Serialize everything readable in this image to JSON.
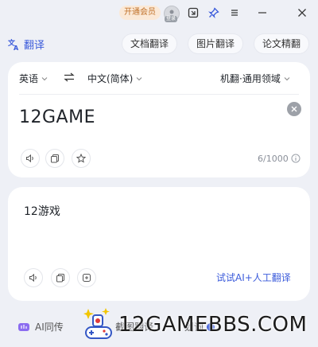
{
  "titlebar": {
    "vip_label": "开通会员",
    "avatar_label": "登录"
  },
  "toolbar": {
    "brand": "翻译",
    "doc_translate": "文档翻译",
    "image_translate": "图片翻译",
    "paper_polish": "论文精翻"
  },
  "source": {
    "lang": "英语",
    "target_lang": "中文(简体)",
    "engine": "机翻·通用领域",
    "text": "12GAME",
    "counter": "6/1000"
  },
  "result": {
    "text": "12游戏",
    "ai_link": "试试AI+人工翻译"
  },
  "bottom": {
    "ai_interpret": "AI同传",
    "screenshot_translate": "截图翻译",
    "word_pick": "划词"
  },
  "watermark": {
    "text": "12GAMEBBS.COM"
  },
  "colors": {
    "accent": "#3b5bdb",
    "vip_bg": "#fbe9d7",
    "vip_text": "#c0712a"
  }
}
